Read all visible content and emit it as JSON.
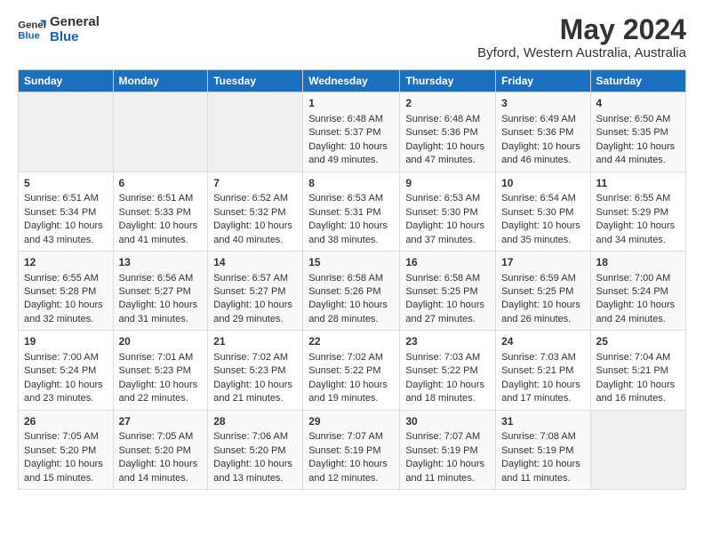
{
  "header": {
    "logo_line1": "General",
    "logo_line2": "Blue",
    "main_title": "May 2024",
    "subtitle": "Byford, Western Australia, Australia"
  },
  "columns": [
    "Sunday",
    "Monday",
    "Tuesday",
    "Wednesday",
    "Thursday",
    "Friday",
    "Saturday"
  ],
  "weeks": [
    [
      {
        "day": "",
        "info": ""
      },
      {
        "day": "",
        "info": ""
      },
      {
        "day": "",
        "info": ""
      },
      {
        "day": "1",
        "info": "Sunrise: 6:48 AM\nSunset: 5:37 PM\nDaylight: 10 hours and 49 minutes."
      },
      {
        "day": "2",
        "info": "Sunrise: 6:48 AM\nSunset: 5:36 PM\nDaylight: 10 hours and 47 minutes."
      },
      {
        "day": "3",
        "info": "Sunrise: 6:49 AM\nSunset: 5:36 PM\nDaylight: 10 hours and 46 minutes."
      },
      {
        "day": "4",
        "info": "Sunrise: 6:50 AM\nSunset: 5:35 PM\nDaylight: 10 hours and 44 minutes."
      }
    ],
    [
      {
        "day": "5",
        "info": "Sunrise: 6:51 AM\nSunset: 5:34 PM\nDaylight: 10 hours and 43 minutes."
      },
      {
        "day": "6",
        "info": "Sunrise: 6:51 AM\nSunset: 5:33 PM\nDaylight: 10 hours and 41 minutes."
      },
      {
        "day": "7",
        "info": "Sunrise: 6:52 AM\nSunset: 5:32 PM\nDaylight: 10 hours and 40 minutes."
      },
      {
        "day": "8",
        "info": "Sunrise: 6:53 AM\nSunset: 5:31 PM\nDaylight: 10 hours and 38 minutes."
      },
      {
        "day": "9",
        "info": "Sunrise: 6:53 AM\nSunset: 5:30 PM\nDaylight: 10 hours and 37 minutes."
      },
      {
        "day": "10",
        "info": "Sunrise: 6:54 AM\nSunset: 5:30 PM\nDaylight: 10 hours and 35 minutes."
      },
      {
        "day": "11",
        "info": "Sunrise: 6:55 AM\nSunset: 5:29 PM\nDaylight: 10 hours and 34 minutes."
      }
    ],
    [
      {
        "day": "12",
        "info": "Sunrise: 6:55 AM\nSunset: 5:28 PM\nDaylight: 10 hours and 32 minutes."
      },
      {
        "day": "13",
        "info": "Sunrise: 6:56 AM\nSunset: 5:27 PM\nDaylight: 10 hours and 31 minutes."
      },
      {
        "day": "14",
        "info": "Sunrise: 6:57 AM\nSunset: 5:27 PM\nDaylight: 10 hours and 29 minutes."
      },
      {
        "day": "15",
        "info": "Sunrise: 6:58 AM\nSunset: 5:26 PM\nDaylight: 10 hours and 28 minutes."
      },
      {
        "day": "16",
        "info": "Sunrise: 6:58 AM\nSunset: 5:25 PM\nDaylight: 10 hours and 27 minutes."
      },
      {
        "day": "17",
        "info": "Sunrise: 6:59 AM\nSunset: 5:25 PM\nDaylight: 10 hours and 26 minutes."
      },
      {
        "day": "18",
        "info": "Sunrise: 7:00 AM\nSunset: 5:24 PM\nDaylight: 10 hours and 24 minutes."
      }
    ],
    [
      {
        "day": "19",
        "info": "Sunrise: 7:00 AM\nSunset: 5:24 PM\nDaylight: 10 hours and 23 minutes."
      },
      {
        "day": "20",
        "info": "Sunrise: 7:01 AM\nSunset: 5:23 PM\nDaylight: 10 hours and 22 minutes."
      },
      {
        "day": "21",
        "info": "Sunrise: 7:02 AM\nSunset: 5:23 PM\nDaylight: 10 hours and 21 minutes."
      },
      {
        "day": "22",
        "info": "Sunrise: 7:02 AM\nSunset: 5:22 PM\nDaylight: 10 hours and 19 minutes."
      },
      {
        "day": "23",
        "info": "Sunrise: 7:03 AM\nSunset: 5:22 PM\nDaylight: 10 hours and 18 minutes."
      },
      {
        "day": "24",
        "info": "Sunrise: 7:03 AM\nSunset: 5:21 PM\nDaylight: 10 hours and 17 minutes."
      },
      {
        "day": "25",
        "info": "Sunrise: 7:04 AM\nSunset: 5:21 PM\nDaylight: 10 hours and 16 minutes."
      }
    ],
    [
      {
        "day": "26",
        "info": "Sunrise: 7:05 AM\nSunset: 5:20 PM\nDaylight: 10 hours and 15 minutes."
      },
      {
        "day": "27",
        "info": "Sunrise: 7:05 AM\nSunset: 5:20 PM\nDaylight: 10 hours and 14 minutes."
      },
      {
        "day": "28",
        "info": "Sunrise: 7:06 AM\nSunset: 5:20 PM\nDaylight: 10 hours and 13 minutes."
      },
      {
        "day": "29",
        "info": "Sunrise: 7:07 AM\nSunset: 5:19 PM\nDaylight: 10 hours and 12 minutes."
      },
      {
        "day": "30",
        "info": "Sunrise: 7:07 AM\nSunset: 5:19 PM\nDaylight: 10 hours and 11 minutes."
      },
      {
        "day": "31",
        "info": "Sunrise: 7:08 AM\nSunset: 5:19 PM\nDaylight: 10 hours and 11 minutes."
      },
      {
        "day": "",
        "info": ""
      }
    ]
  ]
}
